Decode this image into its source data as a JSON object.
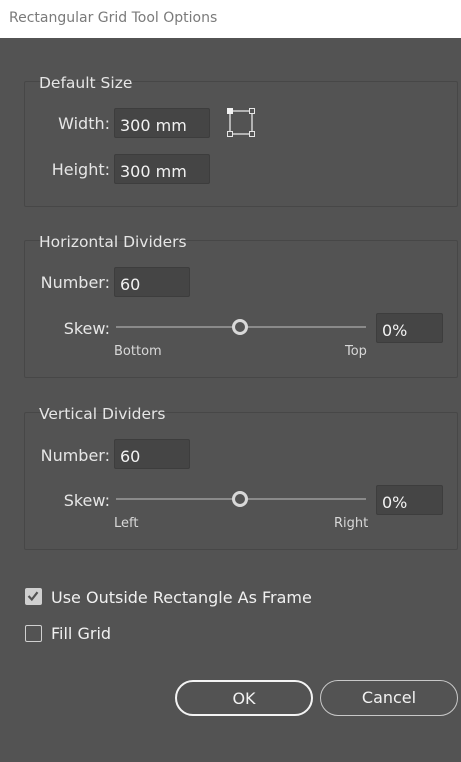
{
  "window": {
    "title": "Rectangular Grid Tool Options"
  },
  "default_size": {
    "title": "Default Size",
    "width_label": "Width:",
    "width_value": "300 mm",
    "height_label": "Height:",
    "height_value": "300 mm",
    "origin_icon": "grid-origin-icon"
  },
  "horizontal_dividers": {
    "title": "Horizontal Dividers",
    "number_label": "Number:",
    "number_value": "60",
    "skew_label": "Skew:",
    "skew_value": "0%",
    "skew_level": 0,
    "min_label": "Bottom",
    "max_label": "Top"
  },
  "vertical_dividers": {
    "title": "Vertical Dividers",
    "number_label": "Number:",
    "number_value": "60",
    "skew_label": "Skew:",
    "skew_value": "0%",
    "skew_level": 0,
    "min_label": "Left",
    "max_label": "Right"
  },
  "options": {
    "use_outside_label": "Use Outside Rectangle As Frame",
    "use_outside_checked": true,
    "fill_grid_label": "Fill Grid",
    "fill_grid_checked": false
  },
  "buttons": {
    "ok": "OK",
    "cancel": "Cancel"
  },
  "colors": {
    "background": "#535353",
    "field": "#454545",
    "text": "#e6e6e6"
  }
}
